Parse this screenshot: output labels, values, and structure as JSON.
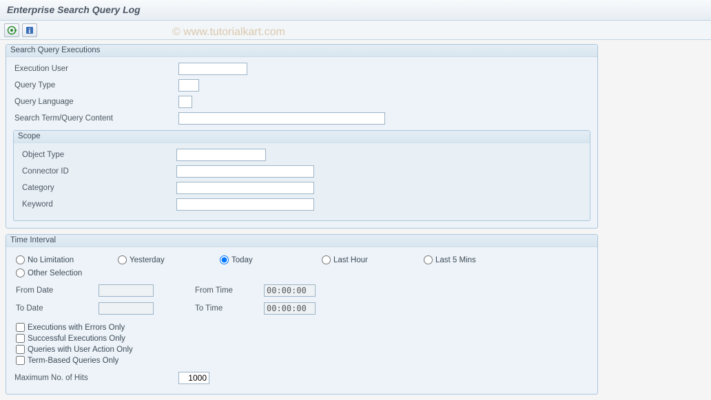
{
  "window_title": "Enterprise Search Query Log",
  "watermark": "© www.tutorialkart.com",
  "toolbar": {
    "execute_icon": "execute",
    "info_icon": "info"
  },
  "panel1": {
    "title": "Search Query Executions",
    "fields": {
      "exec_user_label": "Execution User",
      "exec_user_value": "",
      "query_type_label": "Query Type",
      "query_type_value": "",
      "query_lang_label": "Query Language",
      "query_lang_value": "",
      "search_term_label": "Search Term/Query Content",
      "search_term_value": ""
    },
    "scope": {
      "title": "Scope",
      "object_type_label": "Object Type",
      "object_type_value": "",
      "connector_id_label": "Connector ID",
      "connector_id_value": "",
      "category_label": "Category",
      "category_value": "",
      "keyword_label": "Keyword",
      "keyword_value": ""
    }
  },
  "panel2": {
    "title": "Time Interval",
    "radios": {
      "no_limit": "No Limitation",
      "yesterday": "Yesterday",
      "today": "Today",
      "last_hour": "Last Hour",
      "last_5": "Last 5 Mins",
      "other": "Other Selection",
      "selected": "today"
    },
    "from_date_label": "From Date",
    "from_date_value": "",
    "to_date_label": "To Date",
    "to_date_value": "",
    "from_time_label": "From Time",
    "from_time_value": "00:00:00",
    "to_time_label": "To Time",
    "to_time_value": "00:00:00",
    "checks": {
      "errors_only": "Executions with Errors Only",
      "success_only": "Successful Executions Only",
      "user_action_only": "Queries with User Action Only",
      "term_based_only": "Term-Based Queries Only"
    },
    "max_hits_label": "Maximum No. of Hits",
    "max_hits_value": "1000"
  }
}
